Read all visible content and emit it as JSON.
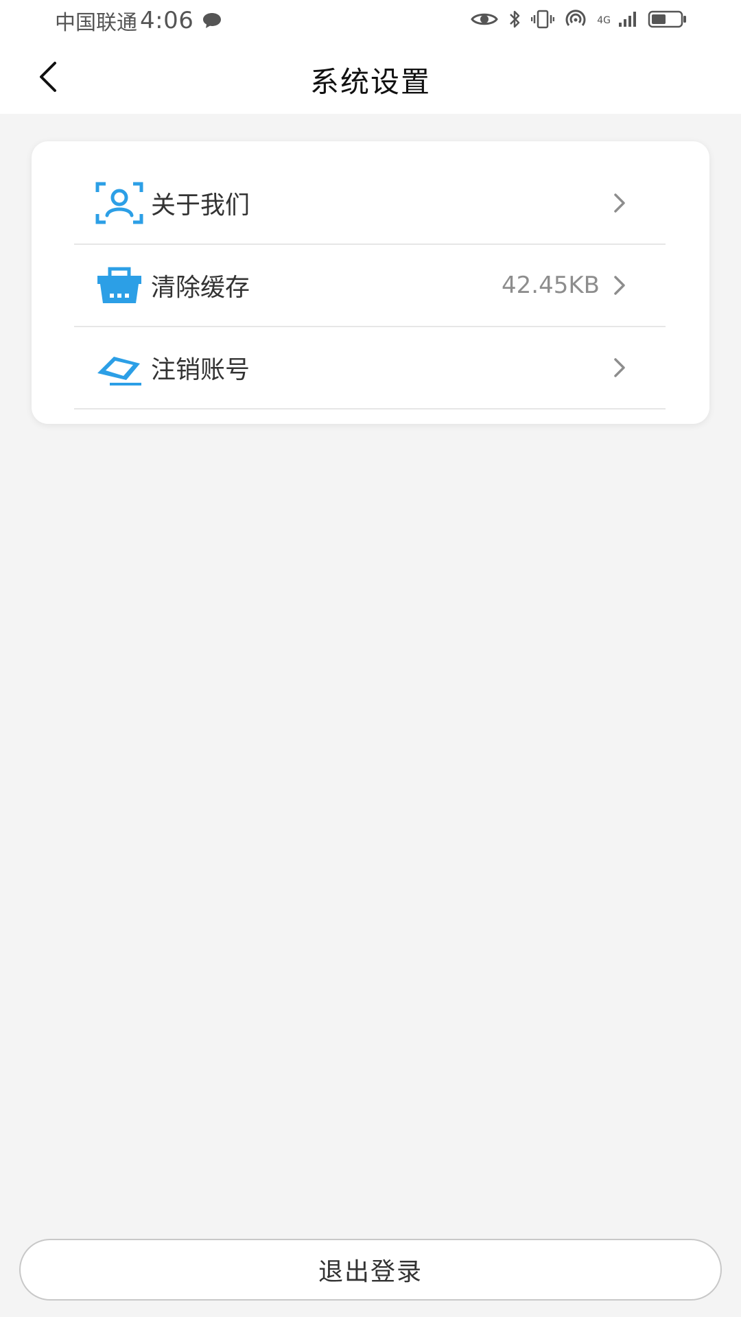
{
  "status_bar": {
    "carrier": "中国联通",
    "time": "4:06",
    "network_type": "4G",
    "icons": [
      "message-icon",
      "eye-icon",
      "bluetooth-icon",
      "vibrate-icon",
      "hotspot-icon",
      "signal-icon",
      "battery-icon"
    ]
  },
  "header": {
    "title": "系统设置",
    "back_icon": "chevron-left-icon"
  },
  "settings": {
    "items": [
      {
        "label": "关于我们",
        "value": "",
        "icon": "user-scan-icon"
      },
      {
        "label": "清除缓存",
        "value": "42.45KB",
        "icon": "basket-icon"
      },
      {
        "label": "注销账号",
        "value": "",
        "icon": "eraser-icon"
      }
    ]
  },
  "footer": {
    "logout_label": "退出登录"
  },
  "colors": {
    "accent": "#2c9fe6",
    "background": "#f4f4f4",
    "card": "#ffffff",
    "divider": "#e6e6e6",
    "muted_text": "#8d8d8d"
  }
}
